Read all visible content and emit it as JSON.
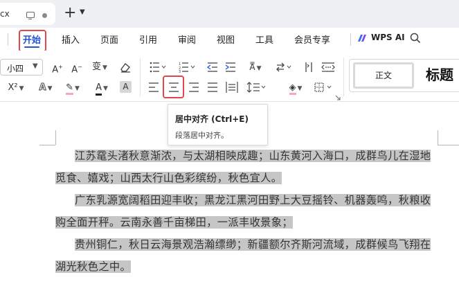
{
  "tab": {
    "name": "cx"
  },
  "menu": {
    "items": [
      "开始",
      "插入",
      "页面",
      "引用",
      "审阅",
      "视图",
      "工具",
      "会员专享"
    ],
    "active": "开始",
    "wps_ai": "WPS AI"
  },
  "ribbon": {
    "font_size": "小四",
    "styles": {
      "normal": "正文",
      "heading": "标题"
    }
  },
  "tooltip": {
    "title": "居中对齐 (Ctrl+E)",
    "description": "段落居中对齐。"
  },
  "document": {
    "paragraphs": [
      {
        "line1": "江苏鼋头渚秋意渐浓，与太湖相映成趣；山东黄河入海口，成群鸟儿在湿地",
        "line2": "觅食、嬉戏；山西太行山色彩缤纷，秋色宜人。"
      },
      {
        "line1": "广东乳源宽阔稻田迎丰收；黑龙江黑河田野上大豆摇铃、机器轰鸣，秋粮收",
        "line2": "购全面开秤。云南永善千亩梯田，一派丰收景象；"
      },
      {
        "line1": "贵州铜仁，秋日云海景观浩瀚缥缈；新疆额尔齐斯河流域，成群候鸟飞翔在",
        "line2": "湖光秋色之中。"
      }
    ]
  },
  "colors": {
    "accent": "#2155d6",
    "highlight_box": "#e0474a",
    "selection": "#c6c6c6"
  }
}
